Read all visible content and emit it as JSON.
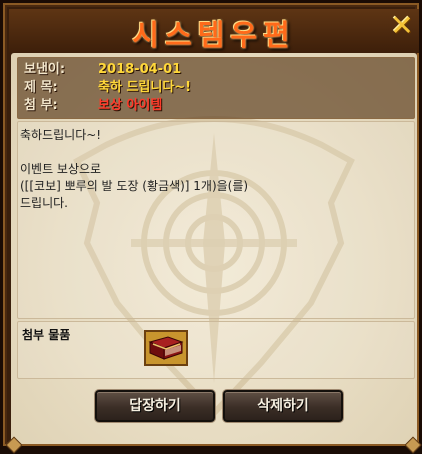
{
  "window": {
    "title": "시스템우편",
    "close_glyph": "✕"
  },
  "header": {
    "sender_label": "보낸이:",
    "sender_value": "2018-04-01",
    "subject_label": "제  목:",
    "subject_value": "축하 드립니다~!",
    "attachment_label": "첨  부:",
    "attachment_value": "보상 아이템"
  },
  "message": {
    "line1": "축하드립니다~!",
    "line2": "이벤트 보상으로",
    "line3": "([[코보] 뽀루의 발 도장 (황금색)] 1개)을(를)",
    "line4": "드립니다."
  },
  "attachment": {
    "label": "첨부 물품",
    "item_icon": "red-book-icon"
  },
  "buttons": {
    "reply": "답장하기",
    "delete": "삭제하기"
  },
  "colors": {
    "title": "#ff6a1a",
    "header_value": "#ffd83a",
    "attachment_value": "#ff3a2a",
    "frame": "#3a1f0c",
    "paper": "#e9dfc7"
  }
}
